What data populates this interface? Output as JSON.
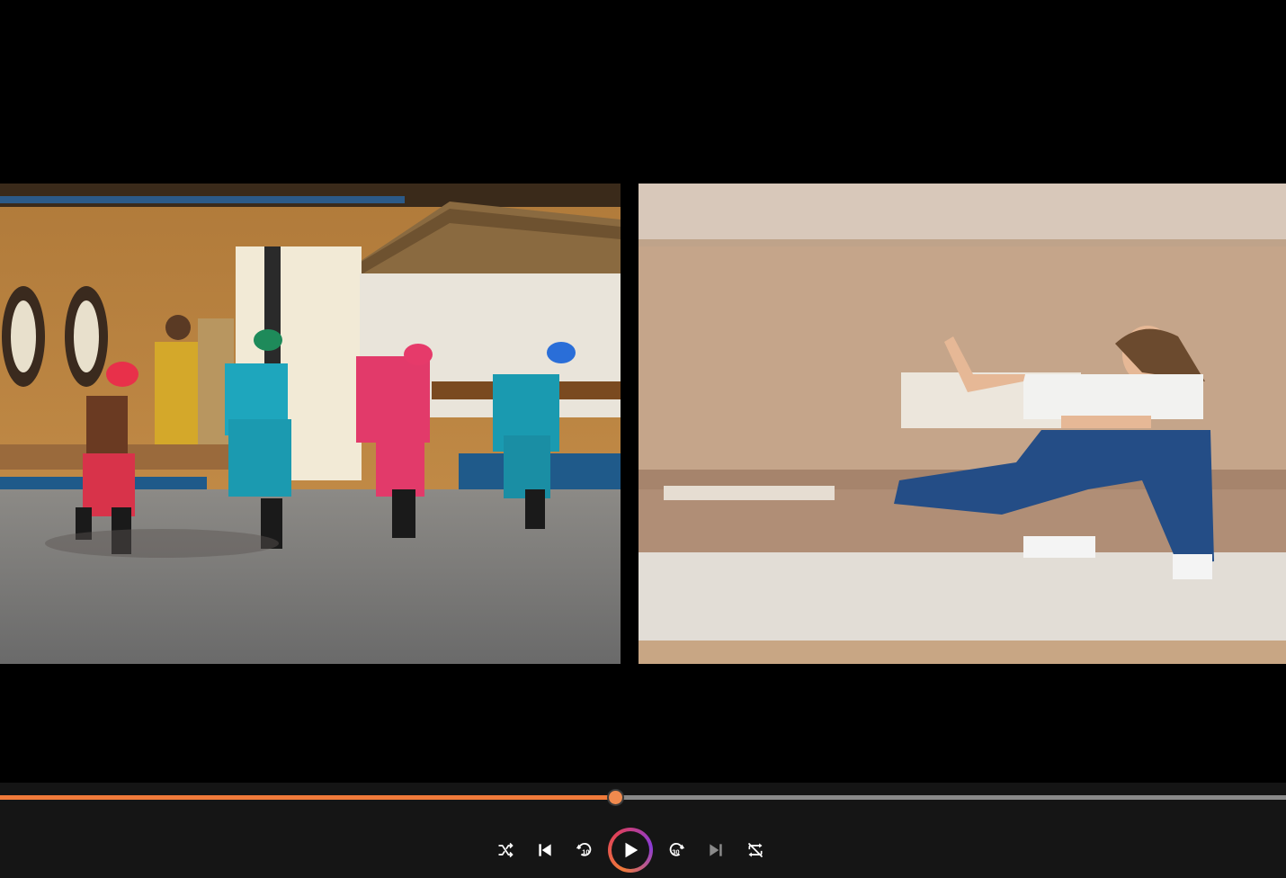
{
  "player": {
    "progress": 0.478,
    "accent_color": "#f07a3a",
    "track_color": "#8a8a8a",
    "bar_background": "#151515"
  },
  "controls": [
    {
      "name": "shuffle-icon",
      "label": "shuffle"
    },
    {
      "name": "skip-previous-icon",
      "label": "previous"
    },
    {
      "name": "rewind-10-icon",
      "label": "10"
    },
    {
      "name": "play-icon",
      "label": "play"
    },
    {
      "name": "forward-30-icon",
      "label": "30"
    },
    {
      "name": "skip-next-icon",
      "label": "next"
    },
    {
      "name": "repeat-off-icon",
      "label": "repeat"
    }
  ],
  "media": {
    "left_video": "dancers-in-hard-hats",
    "right_video": "woman-dancing-living-room"
  }
}
